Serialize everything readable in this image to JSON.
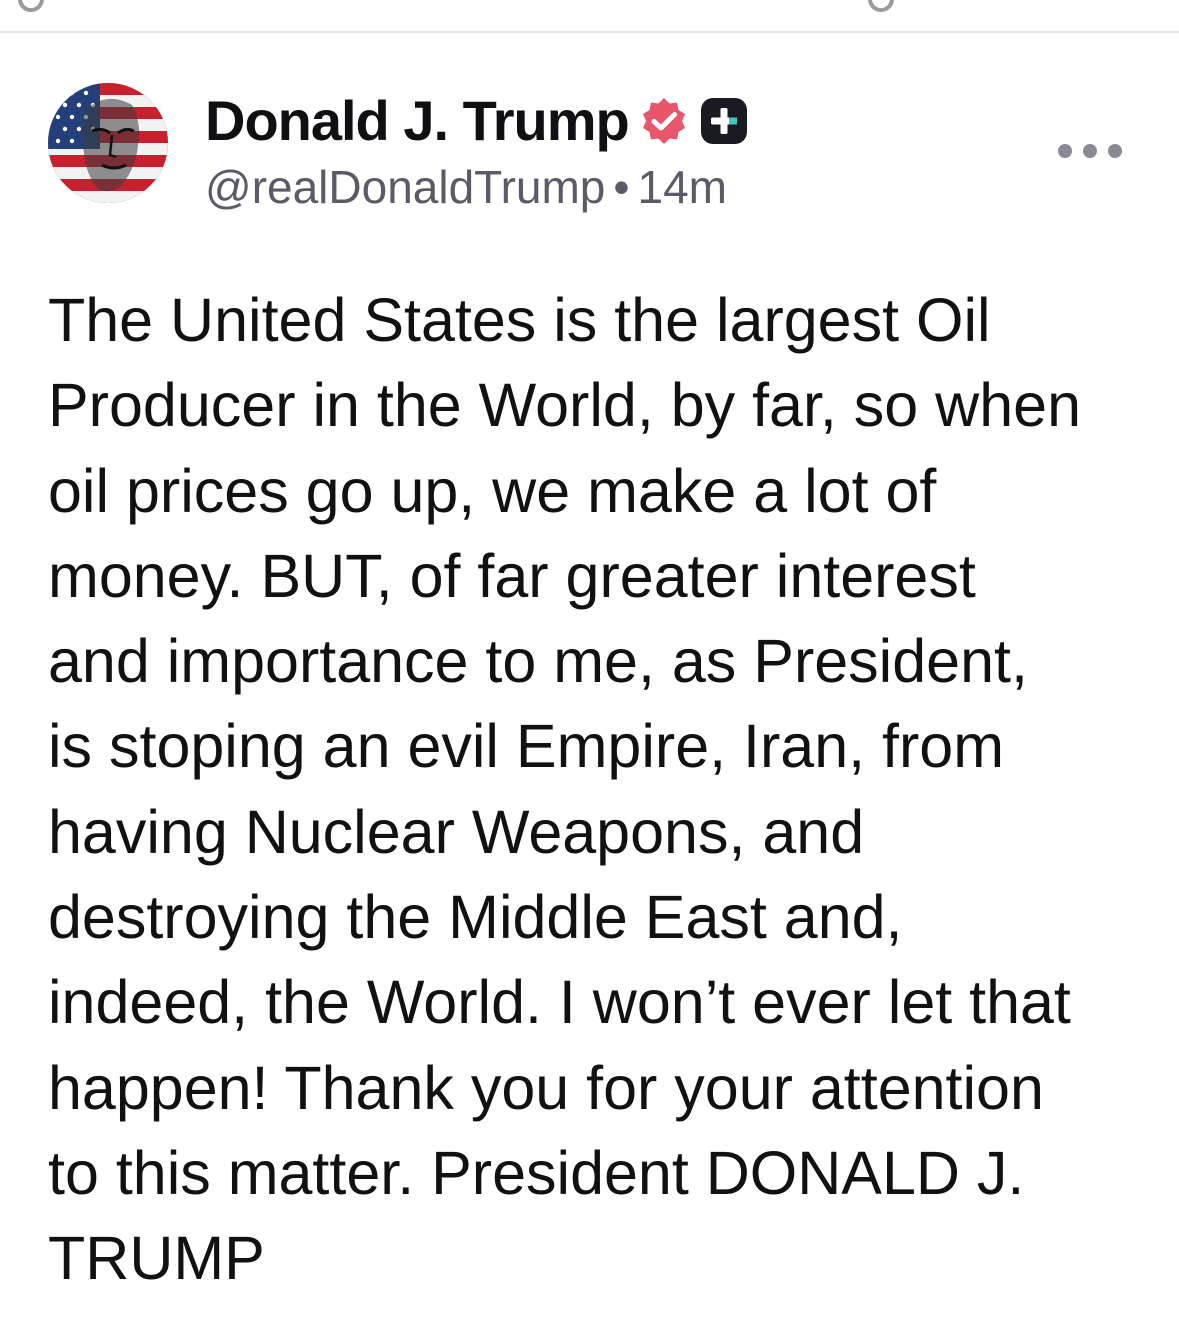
{
  "post": {
    "author": {
      "display_name": "Donald J. Trump",
      "handle": "@realDonaldTrump",
      "separator": "•",
      "time_ago": "14m",
      "verified_icon": "verified-badge-icon",
      "plus_icon": "plus-badge-icon",
      "avatar_icon": "avatar-american-flag-portrait"
    },
    "more_icon": "more-options-icon",
    "body_lines": [
      "The United States is the largest Oil",
      "Producer in the World, by far, so when",
      "oil prices go up, we make a lot of",
      "money. BUT, of far greater interest",
      "and importance to me, as President,",
      "is stoping an evil Empire, Iran, from",
      "having Nuclear Weapons, and",
      "destroying the Middle East and,",
      "indeed, the World. I won’t ever let that",
      "happen! Thank you for your attention",
      "to this matter. President DONALD J.",
      "TRUMP"
    ]
  },
  "colors": {
    "verified_badge": "#e8566b",
    "plus_badge": "#1a1b22",
    "handle_text": "#5b5b68",
    "divider": "#e6e6e6"
  }
}
